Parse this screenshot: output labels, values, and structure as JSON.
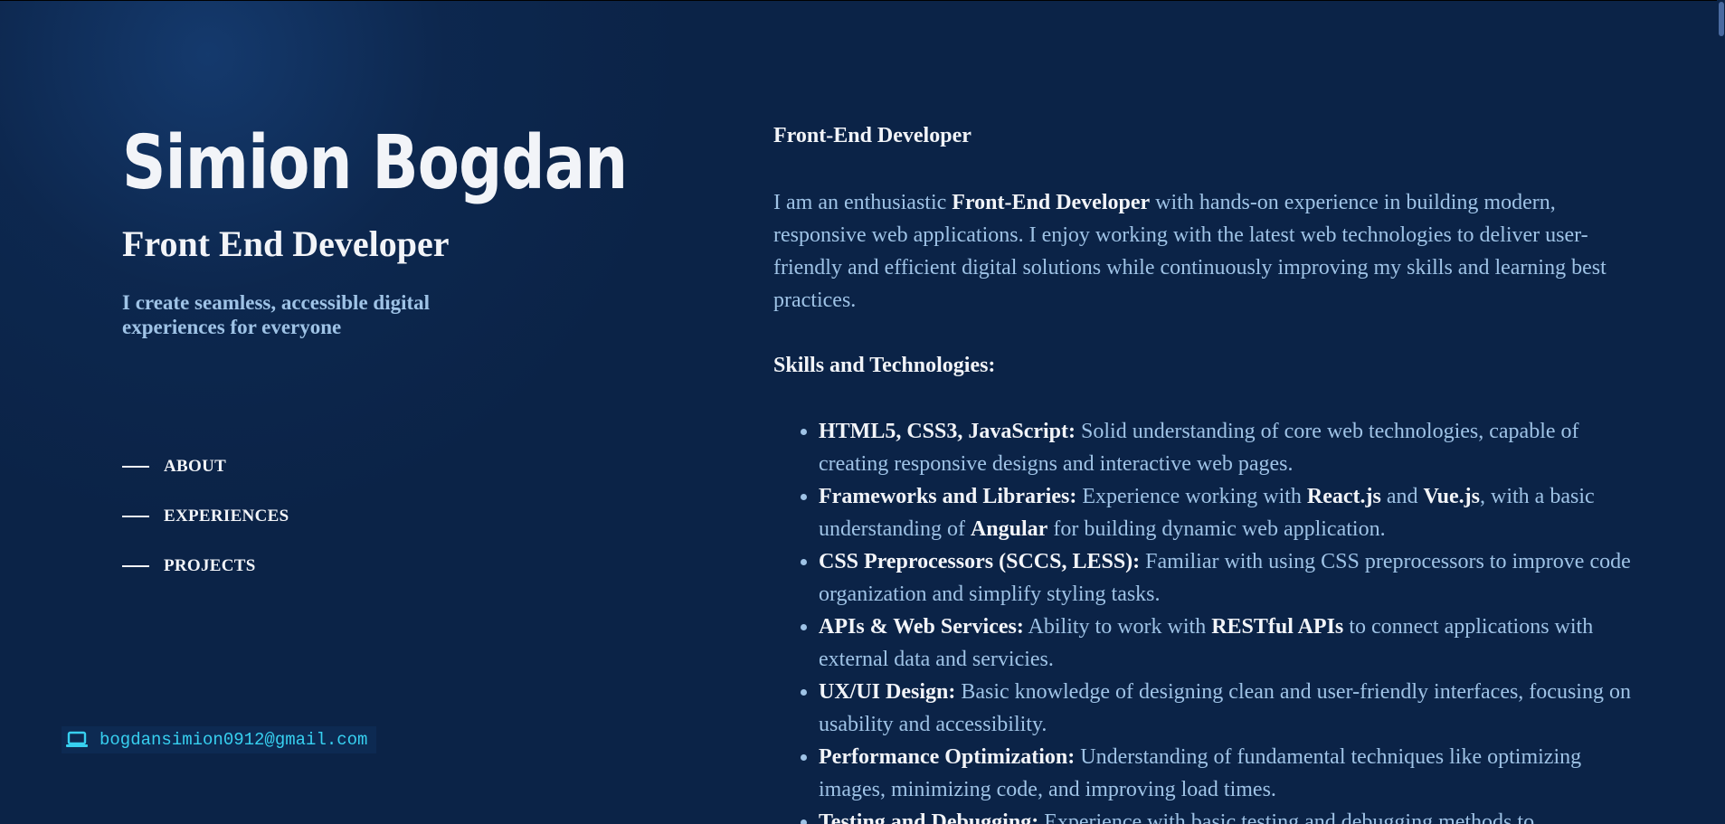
{
  "profile": {
    "name": "Simion Bogdan",
    "role": "Front End Developer",
    "tagline": "I create seamless, accessible digital experiences for everyone"
  },
  "nav": {
    "items": [
      {
        "label": "ABOUT"
      },
      {
        "label": "EXPERIENCES"
      },
      {
        "label": "PROJECTS"
      }
    ]
  },
  "contact": {
    "icon": "laptop-icon",
    "email": "bogdansimion0912@gmail.com"
  },
  "about": {
    "heading": "Front-End Developer",
    "intro_pre": "I am an enthusiastic ",
    "intro_bold": "Front-End Developer",
    "intro_post": " with hands-on experience in building modern, responsive web applications. I enjoy working with the latest web technologies to deliver user-friendly and efficient digital solutions while continuously improving my skills and learning best practices.",
    "skills_heading": "Skills and Technologies:",
    "skills": [
      {
        "lead": "HTML5, CSS3, JavaScript:",
        "text": " Solid understanding of core web technologies, capable of creating responsive designs and interactive web pages."
      },
      {
        "lead": "Frameworks and Libraries:",
        "t1": " Experience working with ",
        "b1": "React.js",
        "t2": " and ",
        "b2": "Vue.js",
        "t3": ", with a basic understanding of ",
        "b3": "Angular",
        "t4": " for building dynamic web application."
      },
      {
        "lead": "CSS Preprocessors (SCCS, LESS):",
        "text": " Familiar with using CSS preprocessors to improve code organization and simplify styling tasks."
      },
      {
        "lead": "APIs & Web Services:",
        "t1": " Ability to work with ",
        "b1": "RESTful APIs",
        "t2": " to connect applications with external data and servicies."
      },
      {
        "lead": "UX/UI Design:",
        "text": " Basic knowledge of designing clean and user-friendly interfaces, focusing on usability and accessibility."
      },
      {
        "lead": "Performance Optimization:",
        "text": " Understanding of fundamental techniques like optimizing images, minimizing code, and improving load times."
      },
      {
        "lead": "Testing and Debugging:",
        "text": " Experience with basic testing and debugging methods to"
      }
    ]
  },
  "colors": {
    "background": "#0b2347",
    "heading": "#f2f4f8",
    "body_text": "#9fc3e6",
    "accent": "#37d0f0"
  }
}
